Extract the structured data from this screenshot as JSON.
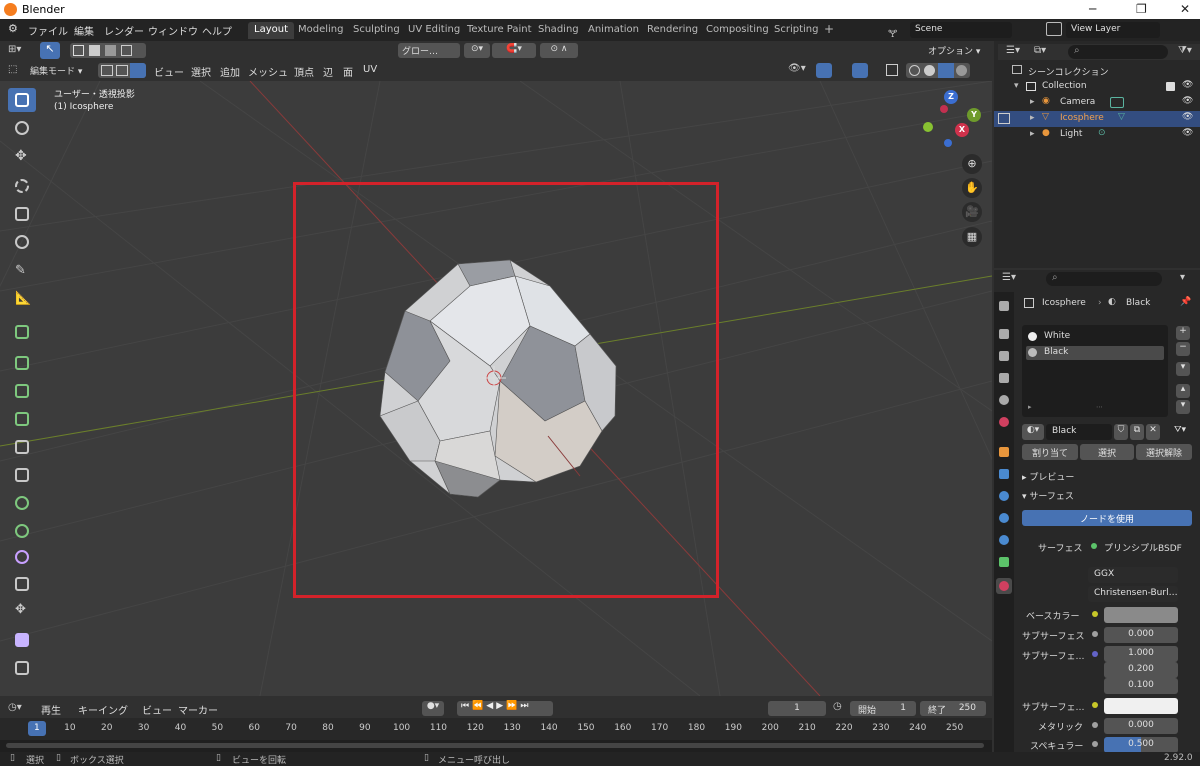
{
  "window": {
    "title": "Blender"
  },
  "menu": [
    "ファイル",
    "編集",
    "レンダー",
    "ウィンドウ",
    "ヘルプ"
  ],
  "workspaces": [
    {
      "label": "Layout",
      "active": true
    },
    {
      "label": "Modeling"
    },
    {
      "label": "Sculpting"
    },
    {
      "label": "UV Editing"
    },
    {
      "label": "Texture Paint"
    },
    {
      "label": "Shading"
    },
    {
      "label": "Animation"
    },
    {
      "label": "Rendering"
    },
    {
      "label": "Compositing"
    },
    {
      "label": "Scripting"
    }
  ],
  "add_workspace": "+",
  "scene": {
    "name": "Scene",
    "view_layer": "View Layer"
  },
  "header": {
    "transform": "グロー…",
    "options": "オプション"
  },
  "header2": {
    "mode": "編集モード",
    "menus": [
      "ビュー",
      "選択",
      "追加",
      "メッシュ",
      "頂点",
      "辺",
      "面",
      "UV"
    ]
  },
  "viewport": {
    "view_label": "ユーザー・透視投影",
    "object_label": "(1) Icosphere",
    "axes": {
      "z": "Z",
      "y": "Y",
      "x": "X"
    }
  },
  "outliner": {
    "root": "シーンコレクション",
    "collection": "Collection",
    "items": [
      {
        "label": "Camera",
        "selected": false
      },
      {
        "label": "Icosphere",
        "selected": true
      },
      {
        "label": "Light",
        "selected": false
      }
    ]
  },
  "properties": {
    "breadcrumb_object": "Icosphere",
    "breadcrumb_material": "Black",
    "slots": [
      "White",
      "Black"
    ],
    "material_name": "Black",
    "assign": "割り当て",
    "select": "選択",
    "deselect": "選択解除",
    "preview_panel": "プレビュー",
    "surface_panel": "サーフェス",
    "use_nodes": "ノードを使用",
    "surface_label": "サーフェス",
    "surface_value": "プリンシプルBSDF",
    "distribution": "GGX",
    "subsurface_method": "Christensen-Burl…",
    "base_color_label": "ベースカラー",
    "subsurface_label": "サブサーフェス",
    "subsurface_value": "0.000",
    "subsurface_radius_label": "サブサーフェ…",
    "radius": [
      "1.000",
      "0.200",
      "0.100"
    ],
    "subsurface_color_label": "サブサーフェ…",
    "metallic_label": "メタリック",
    "metallic_value": "0.000",
    "specular_label": "スペキュラー",
    "specular_value": "0.500"
  },
  "timeline": {
    "menus": [
      "再生",
      "キーイング",
      "ビュー",
      "マーカー"
    ],
    "current_frame": "1",
    "start_label": "開始",
    "start": "1",
    "end_label": "終了",
    "end": "250",
    "ruler": [
      "1",
      "10",
      "20",
      "30",
      "40",
      "50",
      "60",
      "70",
      "80",
      "90",
      "100",
      "110",
      "120",
      "130",
      "140",
      "150",
      "160",
      "170",
      "180",
      "190",
      "200",
      "210",
      "220",
      "230",
      "240",
      "250"
    ]
  },
  "status": {
    "select": "選択",
    "box_select": "ボックス選択",
    "rotate": "ビューを回転",
    "menu": "メニュー呼び出し",
    "version": "2.92.0"
  },
  "colors": {
    "accent": "#4772b3",
    "selection_box": "#d4222a"
  }
}
